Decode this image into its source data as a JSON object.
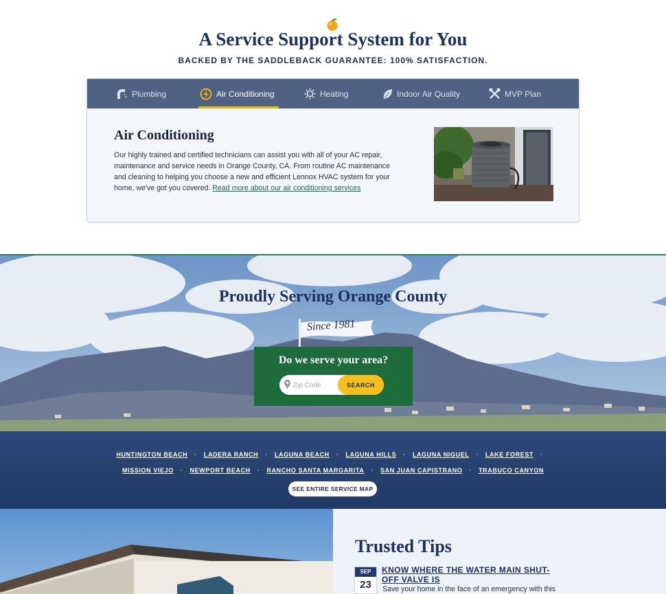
{
  "header": {
    "title": "A Service Support System for You",
    "subtitle": "BACKED BY THE SADDLEBACK GUARANTEE: 100% SATISFACTION."
  },
  "services": {
    "tabs": [
      {
        "label": "Plumbing",
        "icon": "plumbing-icon"
      },
      {
        "label": "Air Conditioning",
        "icon": "ac-icon",
        "active": true
      },
      {
        "label": "Heating",
        "icon": "heating-icon"
      },
      {
        "label": "Indoor Air Quality",
        "icon": "leaf-icon"
      },
      {
        "label": "MVP Plan",
        "icon": "tools-icon"
      }
    ],
    "active_panel": {
      "heading": "Air Conditioning",
      "body": "Our highly trained and certified technicians can assist you with all of your AC repair, maintenance and service needs in Orange County, CA. From routine AC maintenance and cleaning to helping you choose a new and efficient Lennox HVAC system for your home, we've got you covered.",
      "link": "Read more about our air conditioning services"
    }
  },
  "county": {
    "title": "Proudly Serving Orange County",
    "since": "Since 1981",
    "zip_question": "Do we serve your area?",
    "zip_placeholder": "Zip Code",
    "search_label": "SEARCH",
    "city_rows": [
      [
        "HUNTINGTON BEACH",
        "LADERA RANCH",
        "LAGUNA BEACH",
        "LAGUNA HILLS",
        "LAGUNA NIGUEL",
        "LAKE FOREST"
      ],
      [
        "MISSION VIEJO",
        "NEWPORT BEACH",
        "RANCHO SANTA MARGARITA",
        "SAN JUAN CAPISTRANO",
        "TRABUCO CANYON"
      ]
    ],
    "map_button": "SEE ENTIRE SERVICE MAP"
  },
  "tips": {
    "title": "Trusted Tips",
    "date_month": "SEP",
    "date_day": "23",
    "post_title": "KNOW WHERE THE WATER MAIN SHUT-OFF VALVE IS",
    "post_excerpt": "Save your home in the face of an emergency with this"
  },
  "colors": {
    "navy": "#1c3060",
    "tab_bar": "#4f6283",
    "accent_yellow": "#f4b400",
    "zip_green": "#1e6b3c",
    "link_green": "#1c6b4a"
  }
}
